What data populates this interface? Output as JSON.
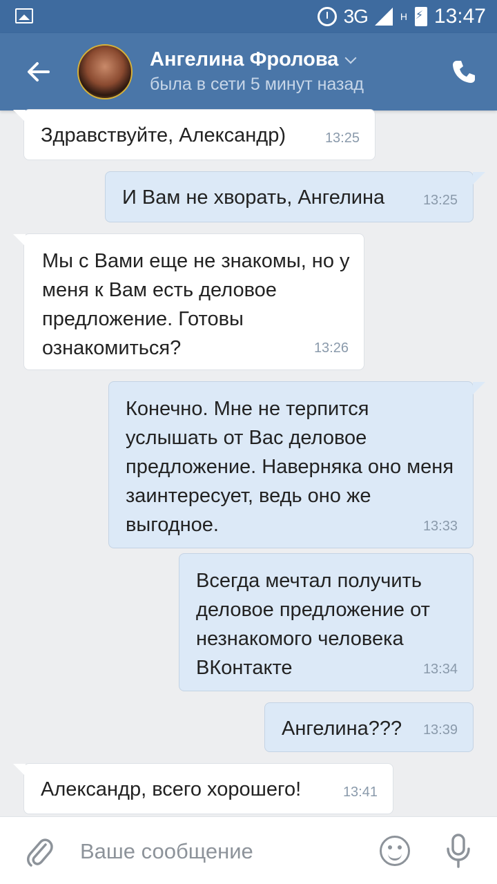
{
  "status_bar": {
    "network": "3G",
    "network_sub": "H",
    "time": "13:47"
  },
  "header": {
    "contact_name": "Ангелина Фролова",
    "presence": "была в сети 5 минут назад"
  },
  "messages": [
    {
      "direction": "in",
      "text": "Здравствуйте, Александр)",
      "time": "13:25"
    },
    {
      "direction": "out",
      "text": "И Вам не хворать, Ангелина",
      "time": "13:25"
    },
    {
      "direction": "in",
      "text": "Мы с Вами еще не знакомы, но у меня к Вам есть деловое предложение. Готовы ознакомиться?",
      "time": "13:26"
    },
    {
      "direction": "out",
      "text": "Конечно. Мне не терпится услышать от Вас деловое предложение. Наверняка оно меня заинтересует, ведь оно же выгодное.",
      "time": "13:33"
    },
    {
      "direction": "out",
      "text": "Всегда мечтал получить деловое предложение от незнакомого человека ВКонтакте",
      "time": "13:34"
    },
    {
      "direction": "out",
      "text": "Ангелина???",
      "time": "13:39"
    },
    {
      "direction": "in",
      "text": "Александр, всего хорошего!",
      "time": "13:41"
    }
  ],
  "input": {
    "placeholder": "Ваше сообщение"
  },
  "icons": {
    "back": "arrow-left-icon",
    "call": "phone-icon",
    "attach": "paperclip-icon",
    "emoji": "smile-icon",
    "voice": "microphone-icon"
  },
  "colors": {
    "header": "#4a76a8",
    "status_bar": "#3e6b9f",
    "incoming_bubble": "#ffffff",
    "outgoing_bubble": "#dce9f7",
    "background": "#edeef0"
  }
}
